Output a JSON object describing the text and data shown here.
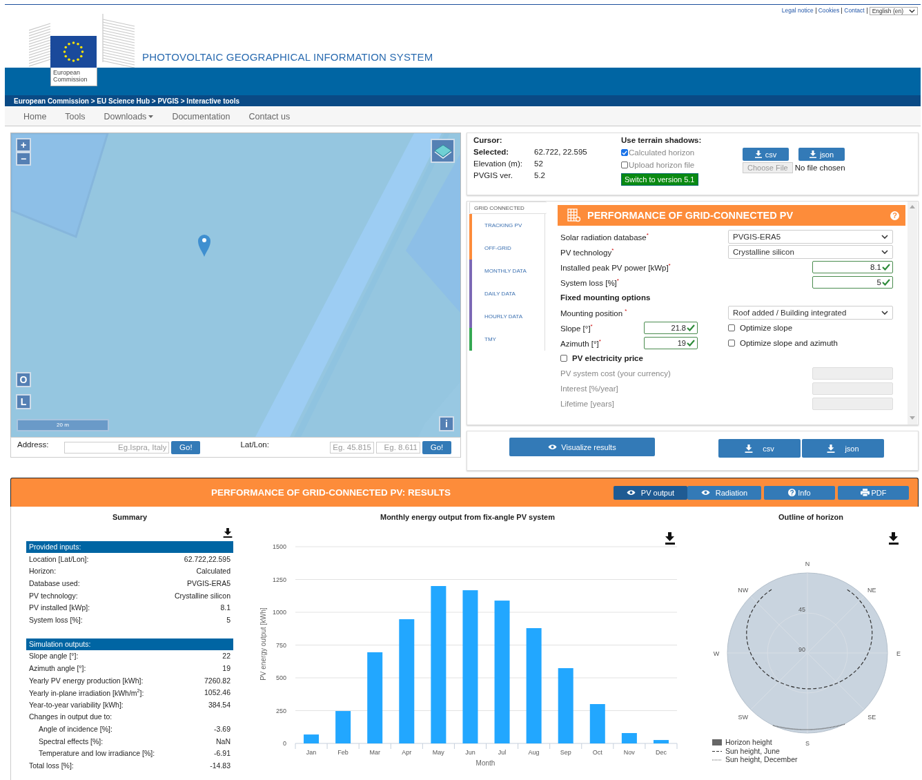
{
  "top_links": [
    {
      "label": "Legal notice"
    },
    {
      "label": "Cookies"
    },
    {
      "label": "Contact"
    }
  ],
  "language": "English (en)",
  "site": {
    "title": "PHOTOVOLTAIC GEOGRAPHICAL INFORMATION SYSTEM",
    "logo_caption": "European Commission"
  },
  "breadcrumb": "European Commission > EU Science Hub > PVGIS > Interactive tools",
  "nav": [
    {
      "label": "Home",
      "dropdown": false
    },
    {
      "label": "Tools",
      "dropdown": false
    },
    {
      "label": "Downloads",
      "dropdown": true
    },
    {
      "label": "Documentation",
      "dropdown": false
    },
    {
      "label": "Contact us",
      "dropdown": false
    }
  ],
  "map": {
    "zoom_in": "+",
    "zoom_out": "−",
    "side_buttons": [
      "O",
      "L"
    ],
    "scale": "20 m",
    "info": "i"
  },
  "search": {
    "address_label": "Address:",
    "address_placeholder": "Eg.Ispra, Italy",
    "go": "Go!",
    "latlon_label": "Lat/Lon:",
    "lat_placeholder": "Eg. 45.815",
    "lon_placeholder": "Eg. 8.611",
    "go_latlon": "Go!"
  },
  "info": {
    "cursor_label": "Cursor:",
    "rows": [
      {
        "label": "Selected:",
        "value": "62.722, 22.595",
        "bold": true
      },
      {
        "label": "Elevation (m):",
        "value": "52",
        "bold": false
      },
      {
        "label": "PVGIS ver.",
        "value": "5.2",
        "bold": false
      }
    ],
    "shadows_title": "Use terrain shadows:",
    "options": [
      {
        "label": "Calculated horizon",
        "checked": true
      },
      {
        "label": "Upload horizon file",
        "checked": false
      }
    ],
    "switch": "Switch to version 5.1",
    "downloads": [
      "csv",
      "json"
    ],
    "file_button": "Choose File",
    "file_status": "No file chosen"
  },
  "tool": {
    "tabs": [
      {
        "label": "GRID CONNECTED",
        "selected": true
      },
      {
        "label": "TRACKING PV",
        "selected": false,
        "color": "#fd8c3a"
      },
      {
        "label": "OFF-GRID",
        "selected": false,
        "color": "#fd8c3a"
      },
      {
        "label": "MONTHLY DATA",
        "selected": false,
        "color": "#7b68b5"
      },
      {
        "label": "DAILY DATA",
        "selected": false,
        "color": "#7b68b5"
      },
      {
        "label": "HOURLY DATA",
        "selected": false,
        "color": "#7b68b5"
      },
      {
        "label": "TMY",
        "selected": false,
        "color": "#35a853"
      }
    ],
    "title": "PERFORMANCE OF GRID-CONNECTED PV",
    "help": "?",
    "rows": [
      {
        "kind": "select",
        "label": "Solar radiation database$^{*}$",
        "value": "PVGIS-ERA5"
      },
      {
        "kind": "select",
        "label": "PV technology$^{*}$",
        "value": "Crystalline silicon"
      },
      {
        "kind": "number",
        "label": "Installed peak PV power [kWp]$^{*}$",
        "value": "8.1",
        "valid": true
      },
      {
        "kind": "number",
        "label": "System loss [%]$^{*}$",
        "value": "5",
        "valid": true
      },
      {
        "kind": "heading",
        "label": "Fixed mounting options"
      },
      {
        "kind": "select",
        "label": "Mounting position $^{*}$",
        "value": "Roof added / Building integrated"
      }
    ],
    "angles": [
      {
        "label": "Slope [°]$^{*}$",
        "value": "21.8",
        "valid": true,
        "option": {
          "label": "Optimize slope",
          "checked": false
        }
      },
      {
        "label": "Azimuth [°]$^{*}$",
        "value": "19",
        "valid": true,
        "option": {
          "label": "Optimize slope and azimuth",
          "checked": false
        }
      }
    ],
    "price": {
      "label": "PV electricity price",
      "checked": false,
      "fields": [
        {
          "label": "PV system cost (your currency)",
          "disabled": true
        },
        {
          "label": "Interest [%/year]",
          "disabled": true
        },
        {
          "label": "Lifetime [years]",
          "disabled": true
        }
      ]
    }
  },
  "actions": {
    "visualize": "Visualize results",
    "downloads": [
      "csv",
      "json"
    ]
  },
  "results": {
    "title": "PERFORMANCE OF GRID-CONNECTED PV: RESULTS",
    "views": [
      {
        "label": "PV output",
        "selected": true
      },
      {
        "label": "Radiation",
        "selected": false
      }
    ],
    "buttons": [
      {
        "kind": "info",
        "label": "Info"
      },
      {
        "kind": "pdf",
        "label": "PDF"
      }
    ],
    "summary": {
      "title": "Summary",
      "sections": [
        {
          "title": "Provided inputs:",
          "rows": [
            {
              "label": "Location [Lat/Lon]:",
              "value": "62.722,22.595"
            },
            {
              "label": "Horizon:",
              "value": "Calculated"
            },
            {
              "label": "Database used:",
              "value": "PVGIS-ERA5"
            },
            {
              "label": "PV technology:",
              "value": "Crystalline silicon"
            },
            {
              "label": "PV installed [kWp]:",
              "value": "8.1"
            },
            {
              "label": "System loss [%]:",
              "value": "5"
            }
          ]
        },
        {
          "title": "Simulation outputs:",
          "rows": [
            {
              "label": "Slope angle [°]:",
              "value": "22"
            },
            {
              "label": "Azimuth angle [°]:",
              "value": "19"
            },
            {
              "label": "Yearly PV energy production [kWh]:",
              "value": "7260.82"
            },
            {
              "label": "Yearly in-plane irradiation [kWh/m$^{2}$]:",
              "value": "1052.46"
            },
            {
              "label": "Year-to-year variability [kWh]:",
              "value": "384.54"
            },
            {
              "label": "Changes in output due to:",
              "children": [
                {
                  "label": "Angle of incidence [%]:",
                  "value": "-3.69"
                },
                {
                  "label": "Spectral effects [%]:",
                  "value": "NaN"
                },
                {
                  "label": "Temperature and low irradiance [%]:",
                  "value": "-6.91"
                }
              ]
            },
            {
              "label": "Total loss [%]:",
              "value": "-14.83"
            }
          ]
        }
      ]
    },
    "chart": {
      "chart_data": {
        "type": "bar",
        "title": "Monthly energy output from fix-angle PV system",
        "xlabel": "Month",
        "ylabel": "PV energy output [kWh]",
        "categories": [
          "Jan",
          "Feb",
          "Mar",
          "Apr",
          "May",
          "Jun",
          "Jul",
          "Aug",
          "Sep",
          "Oct",
          "Nov",
          "Dec"
        ],
        "series": [
          {
            "color": "#22a7ff",
            "values": [
              68,
              247,
              695,
              947,
              1200,
              1168,
              1089,
              879,
              574,
              300,
              79,
              26
            ]
          }
        ],
        "ylim": [
          0,
          1500
        ],
        "grid": true,
        "yticks": [
          0,
          250,
          500,
          750,
          1000,
          1250,
          1500
        ]
      }
    },
    "horizon": {
      "title": "Outline of horizon",
      "directions": [
        "N",
        "NE",
        "E",
        "SE",
        "S",
        "SW",
        "W",
        "NW"
      ],
      "rings": [
        "45",
        "90"
      ],
      "legend": [
        {
          "kind": "area",
          "label": "Horizon height"
        },
        {
          "kind": "dashed",
          "label": "Sun height, June"
        },
        {
          "kind": "dotted",
          "label": "Sun height, December"
        }
      ]
    }
  }
}
